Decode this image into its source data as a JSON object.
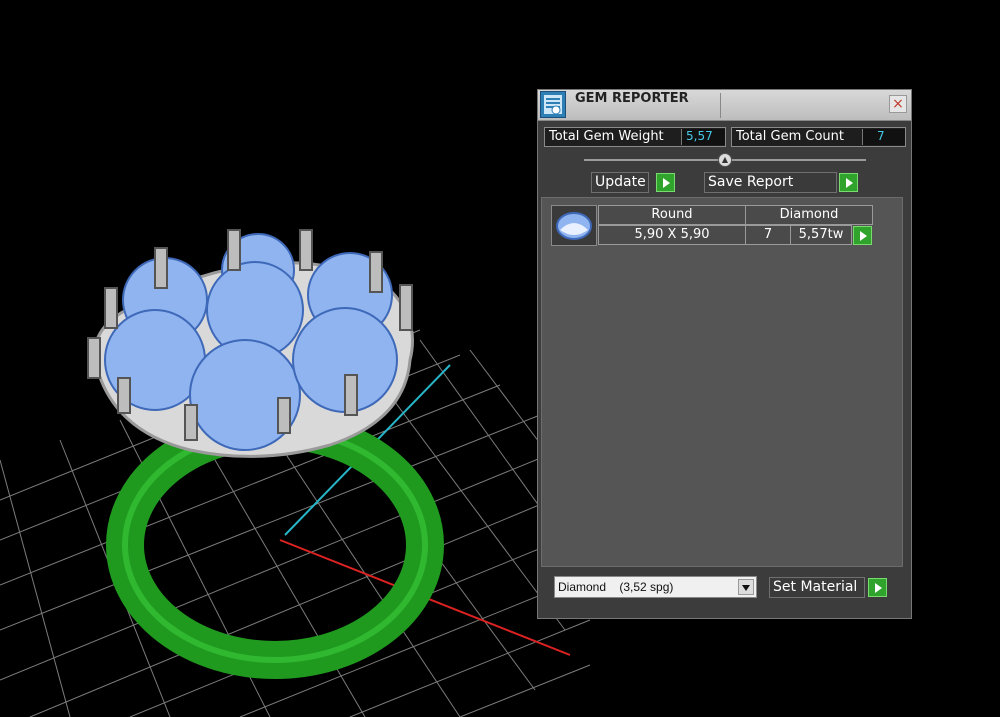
{
  "panel": {
    "title": "GEM REPORTER",
    "close_glyph": "×",
    "total_gem_weight": {
      "label": "Total Gem Weight",
      "value": "5,57"
    },
    "total_gem_count": {
      "label": "Total Gem Count",
      "value": "7"
    },
    "update_label": "Update",
    "save_report_label": "Save Report",
    "gem_row": {
      "shape": "Round",
      "material": "Diamond",
      "size": "5,90 X 5,90",
      "count": "7",
      "weight": "5,57tw"
    },
    "material_select_value": "Diamond    (3,52 spg)",
    "set_material_label": "Set Material"
  },
  "colors": {
    "accent_green": "#2fa32c",
    "value_cyan": "#45c9e8",
    "ring_green": "#1f9a1f",
    "gem_blue": "#8fb4f0"
  },
  "icons": [
    "gem-reporter-icon",
    "close-icon",
    "slider-knob-icon",
    "go-arrow-icon",
    "gem-thumbnail-icon",
    "dropdown-arrow-icon"
  ]
}
